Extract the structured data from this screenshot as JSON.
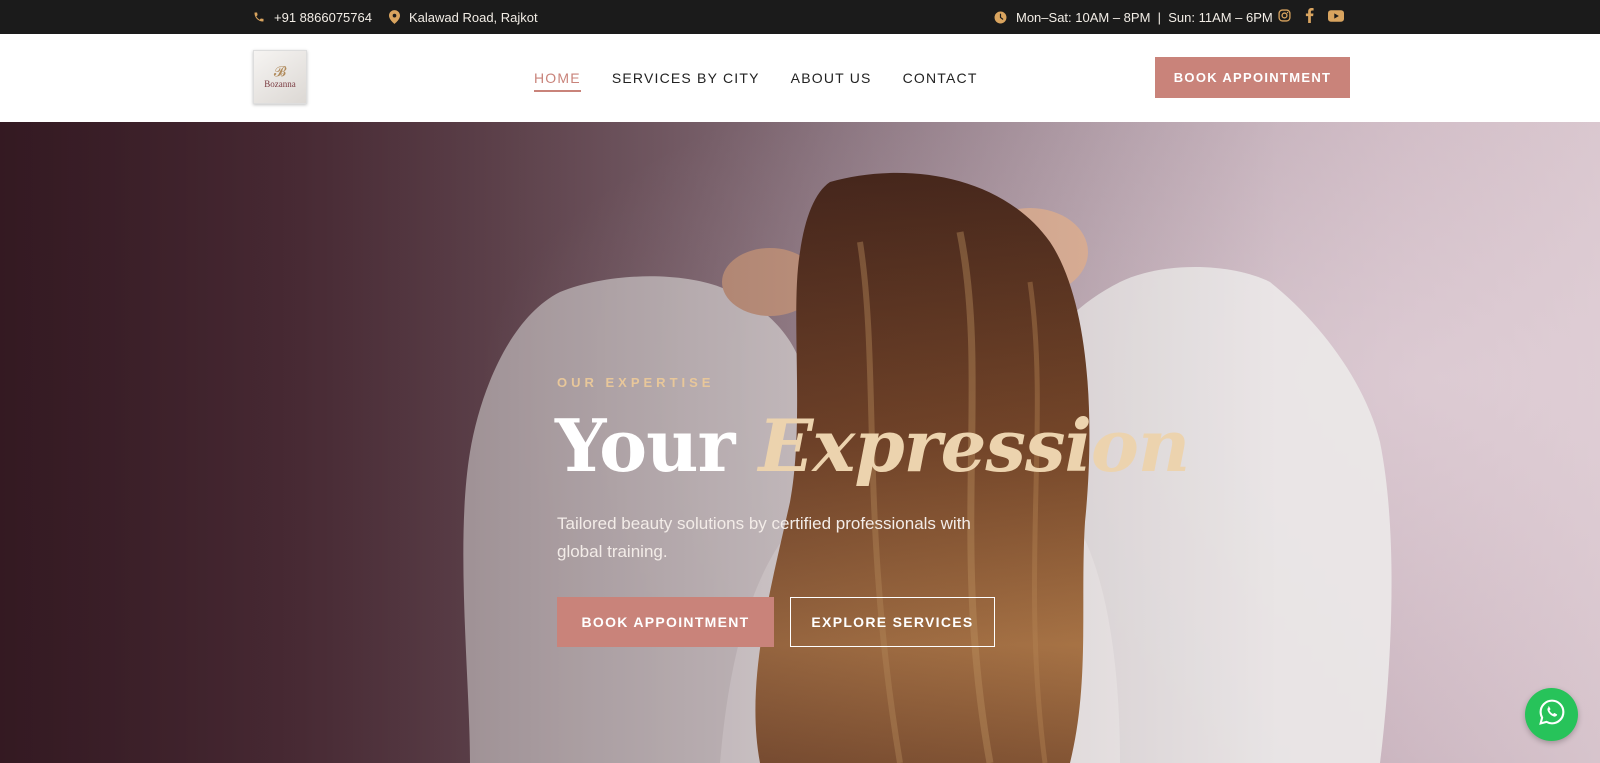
{
  "topbar": {
    "phone": "+91 8866075764",
    "address": "Kalawad Road, Rajkot",
    "hours": "Mon–Sat: 10AM – 8PM  |  Sun: 11AM – 6PM",
    "social": [
      "instagram-icon",
      "facebook-icon",
      "youtube-icon"
    ]
  },
  "header": {
    "logo_text": "Bozanna",
    "nav": [
      {
        "label": "HOME",
        "active": true
      },
      {
        "label": "SERVICES BY CITY",
        "active": false
      },
      {
        "label": "ABOUT US",
        "active": false
      },
      {
        "label": "CONTACT",
        "active": false
      }
    ],
    "cta": "BOOK APPOINTMENT"
  },
  "hero": {
    "eyebrow": "OUR EXPERTISE",
    "headline_plain": "Your",
    "headline_accent": "Expression",
    "subtext": "Tailored beauty solutions by certified professionals with global training.",
    "primary_button": "BOOK APPOINTMENT",
    "secondary_button": "EXPLORE SERVICES"
  },
  "colors": {
    "accent": "#c9837a",
    "gold": "#d9a45f",
    "topbar_bg": "#1b1b1b",
    "whatsapp": "#27c35a"
  }
}
